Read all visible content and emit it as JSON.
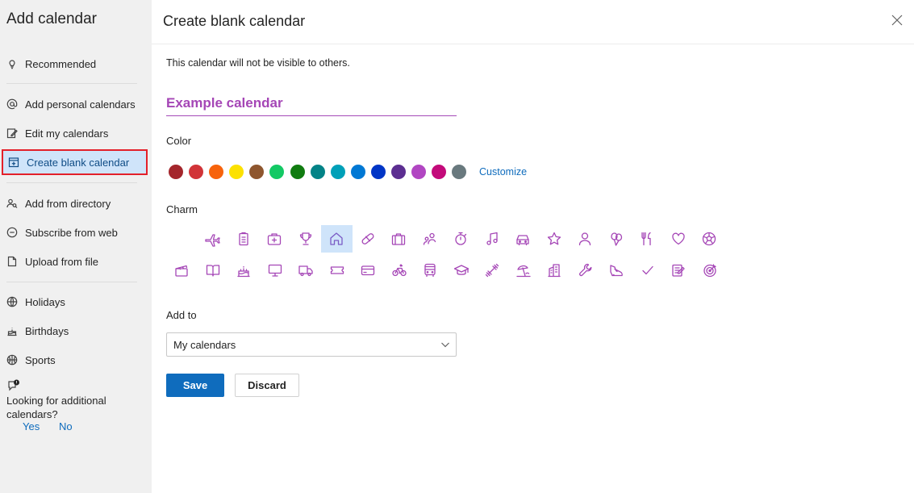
{
  "sidebar": {
    "title": "Add calendar",
    "items": [
      {
        "label": "Recommended",
        "icon": "lightbulb-icon"
      },
      {
        "label": "Add personal calendars",
        "icon": "at-icon"
      },
      {
        "label": "Edit my calendars",
        "icon": "edit-icon"
      },
      {
        "label": "Create blank calendar",
        "icon": "calendar-add-icon",
        "selected": true
      },
      {
        "label": "Add from directory",
        "icon": "people-search-icon"
      },
      {
        "label": "Subscribe from web",
        "icon": "link-icon"
      },
      {
        "label": "Upload from file",
        "icon": "document-icon"
      },
      {
        "label": "Holidays",
        "icon": "globe-icon"
      },
      {
        "label": "Birthdays",
        "icon": "cake-icon"
      },
      {
        "label": "Sports",
        "icon": "basketball-icon"
      }
    ],
    "feedback": {
      "text": "Looking for additional calendars?",
      "yes": "Yes",
      "no": "No"
    }
  },
  "main": {
    "title": "Create blank calendar",
    "description": "This calendar will not be visible to others.",
    "name_placeholder": "Example calendar",
    "color_label": "Color",
    "colors": [
      "#a4262c",
      "#d13438",
      "#f7630c",
      "#fce100",
      "#8e562e",
      "#13c964",
      "#107c10",
      "#038387",
      "#00a0b8",
      "#0078d4",
      "#0035c6",
      "#5c2e91",
      "#b146c2",
      "#c30a7a",
      "#69797e"
    ],
    "customize_label": "Customize",
    "charm_label": "Charm",
    "charms_row1": [
      "airplane-icon",
      "clipboard-icon",
      "first-aid-kit-icon",
      "trophy-icon",
      "home-icon",
      "pill-icon",
      "briefcase-icon",
      "people-icon",
      "stopwatch-icon",
      "music-note-icon",
      "car-icon",
      "star-icon",
      "person-icon",
      "balloons-icon",
      "fork-knife-icon",
      "heart-icon",
      "soccer-ball-icon"
    ],
    "charms_row2": [
      "movie-clapper-icon",
      "book-icon",
      "birthday-cake-icon",
      "monitor-icon",
      "truck-icon",
      "ticket-icon",
      "credit-card-icon",
      "bicycle-icon",
      "bus-icon",
      "graduation-cap-icon",
      "dumbbell-icon",
      "beach-icon",
      "building-icon",
      "wrench-icon",
      "sneaker-icon",
      "checkmark-icon",
      "notepad-icon",
      "target-icon"
    ],
    "selected_charm": "home-icon",
    "add_to_label": "Add to",
    "add_to_value": "My calendars",
    "save_label": "Save",
    "discard_label": "Discard"
  }
}
